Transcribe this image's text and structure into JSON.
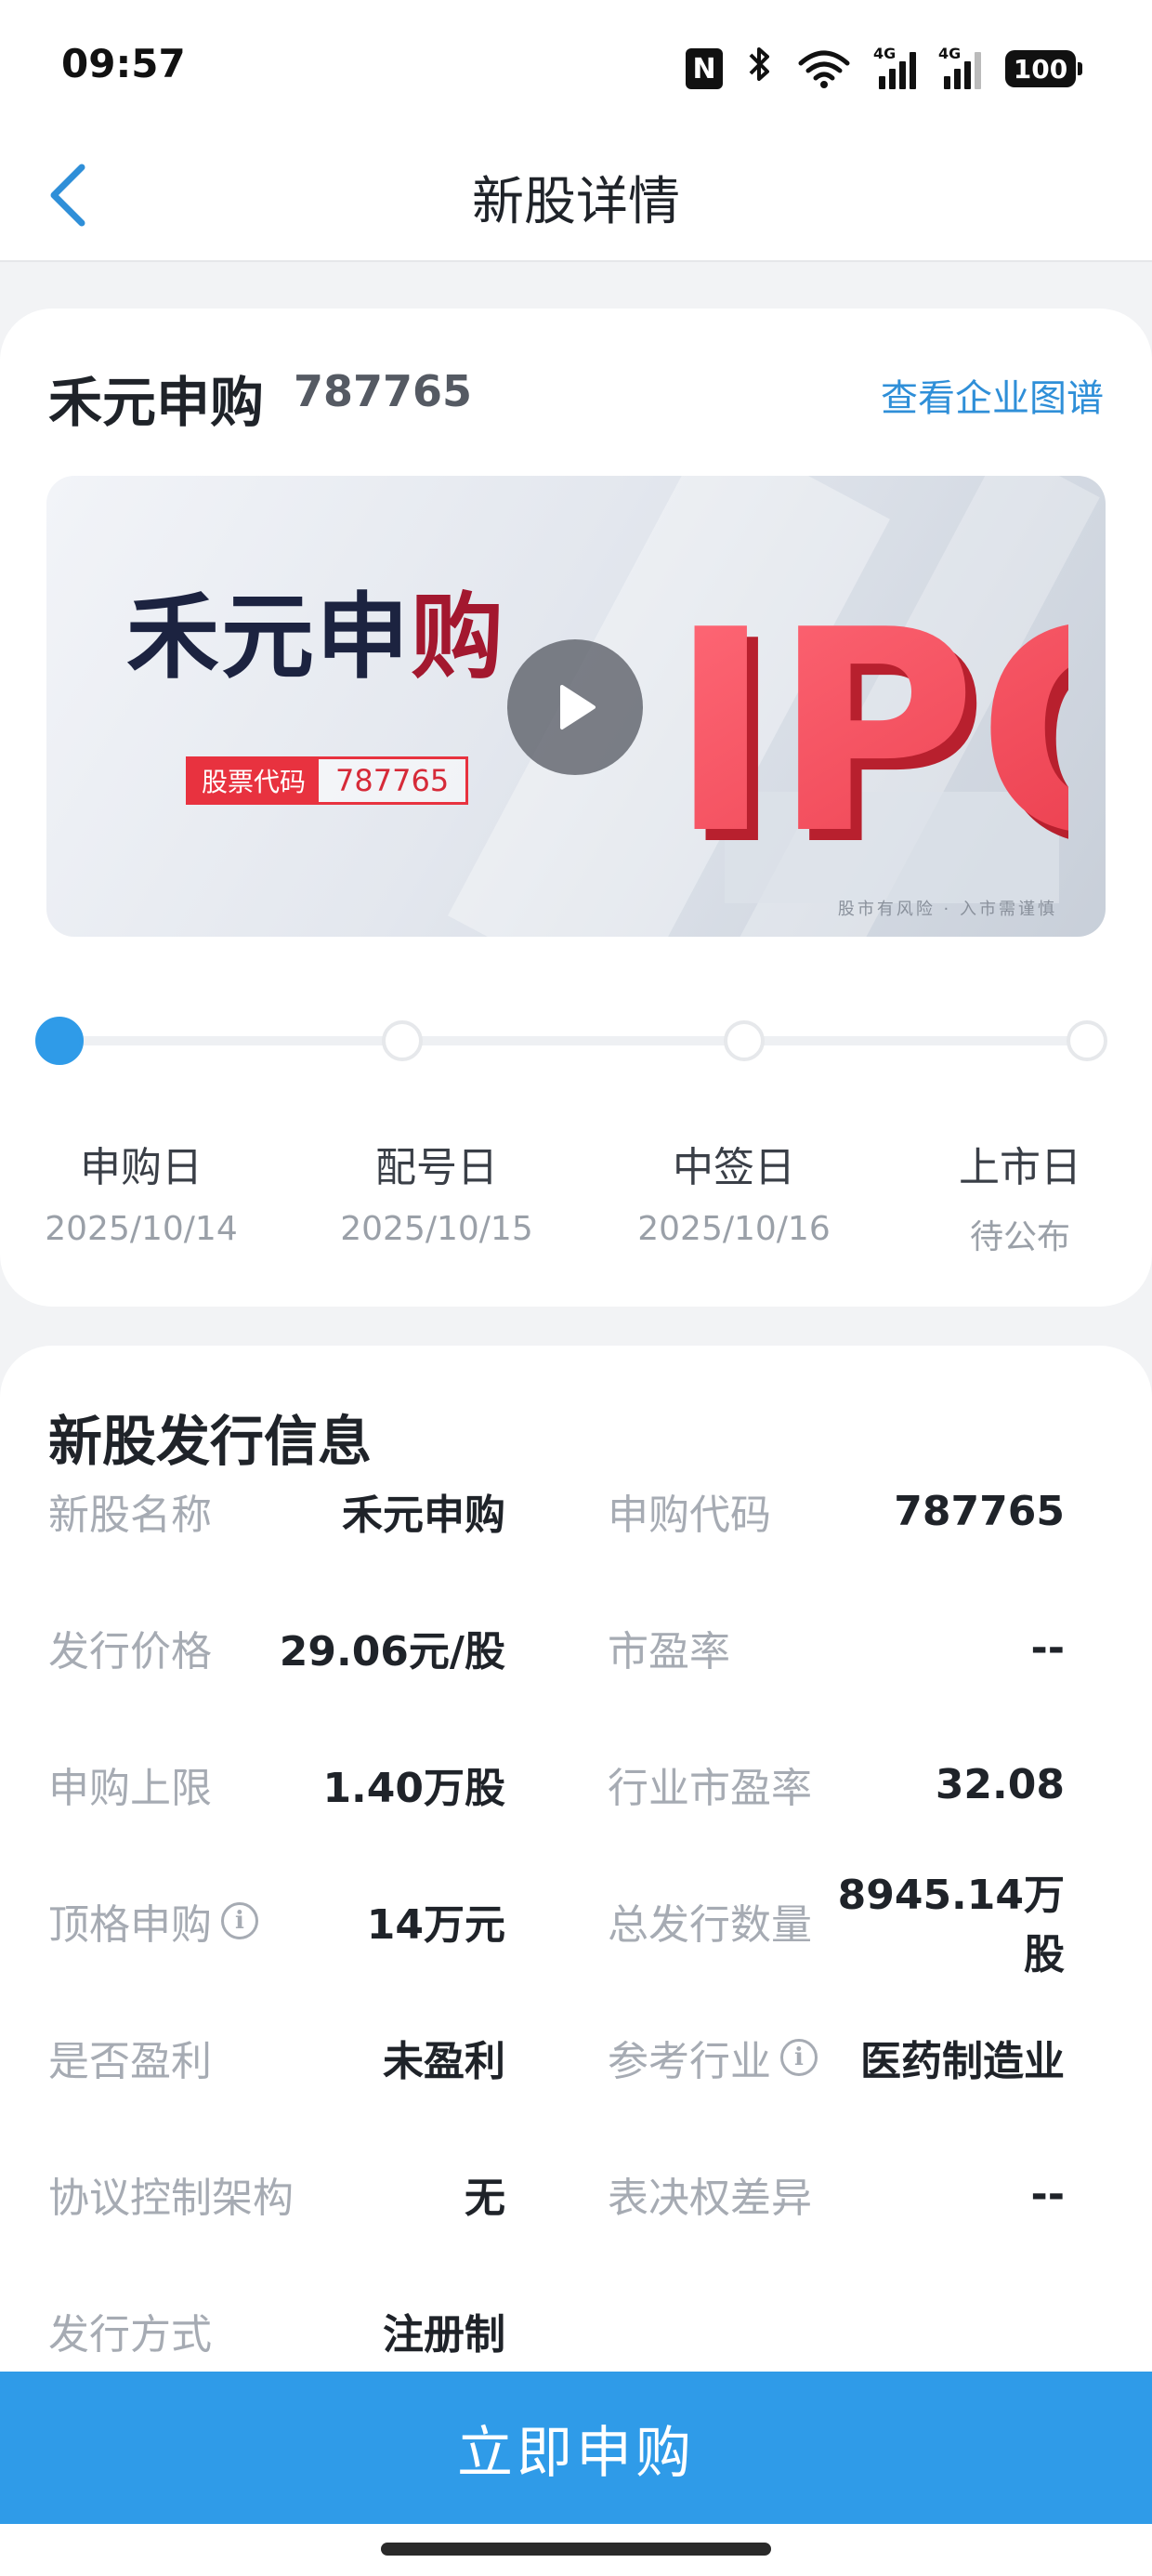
{
  "status_bar": {
    "time": "09:57",
    "nfc_label": "N",
    "signal_tag": "4G",
    "battery": "100"
  },
  "nav": {
    "title": "新股详情",
    "back_icon": "chevron-left-icon"
  },
  "stock": {
    "name": "禾元申购",
    "code": "787765",
    "company_map_link": "查看企业图谱"
  },
  "banner": {
    "title_main": "禾元申",
    "title_accent": "购",
    "code_label": "股票代码",
    "code_value": "787765",
    "graphic_text": "IPO",
    "risk_notice": "股市有风险 · 入市需谨慎",
    "play_icon": "play-icon"
  },
  "timeline": {
    "progress_step": 1,
    "steps": [
      {
        "name": "申购日",
        "date": "2025/10/14"
      },
      {
        "name": "配号日",
        "date": "2025/10/15"
      },
      {
        "name": "中签日",
        "date": "2025/10/16"
      },
      {
        "name": "上市日",
        "date": "待公布"
      }
    ]
  },
  "info": {
    "section_title": "新股发行信息",
    "rows": [
      {
        "left_label": "新股名称",
        "left_value": "禾元申购",
        "right_label": "申购代码",
        "right_value": "787765"
      },
      {
        "left_label": "发行价格",
        "left_value": "29.06元/股",
        "right_label": "市盈率",
        "right_value": "--"
      },
      {
        "left_label": "申购上限",
        "left_value": "1.40万股",
        "right_label": "行业市盈率",
        "right_value": "32.08"
      },
      {
        "left_label": "顶格申购",
        "left_value": "14万元",
        "right_label": "总发行数量",
        "right_value": "8945.14万股"
      },
      {
        "left_label": "是否盈利",
        "left_value": "未盈利",
        "right_label": "参考行业",
        "right_value": "医药制造业"
      },
      {
        "left_label": "协议控制架构",
        "left_value": "无",
        "right_label": "表决权差异",
        "right_value": "--"
      },
      {
        "left_label": "发行方式",
        "left_value": "注册制",
        "right_label": "",
        "right_value": ""
      }
    ],
    "info_icon_glyph": "i"
  },
  "cta": {
    "subscribe_label": "立即申购"
  }
}
